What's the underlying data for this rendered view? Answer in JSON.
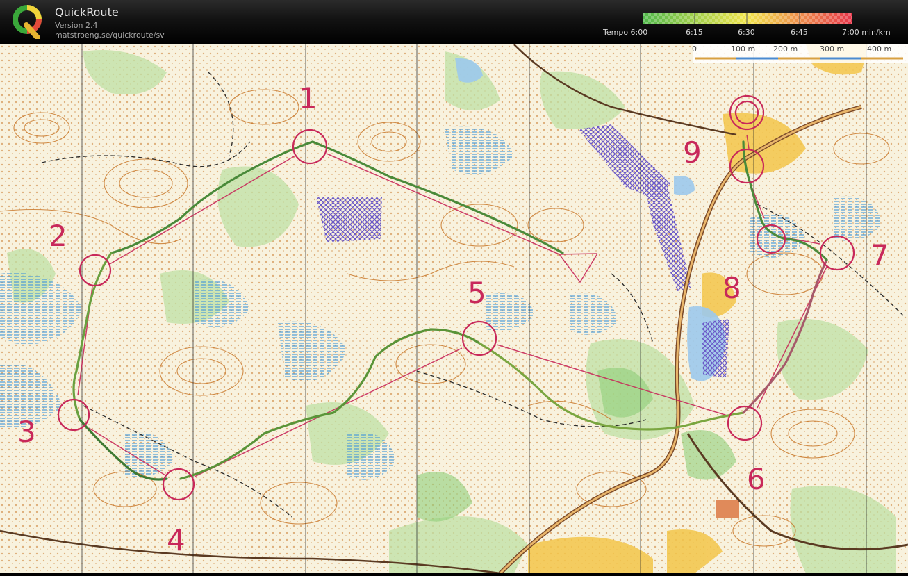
{
  "app": {
    "title": "QuickRoute",
    "version": "Version 2.4",
    "url": "matstroeng.se/quickroute/sv"
  },
  "pace_legend": {
    "prefix": "Tempo",
    "ticks": [
      "6:00",
      "6:15",
      "6:30",
      "6:45",
      "7:00"
    ],
    "unit": "min/km",
    "colors": [
      "#4fb84a",
      "#f2e54a",
      "#e8364a"
    ]
  },
  "map": {
    "scale_labels": [
      "0",
      "100 m",
      "200 m",
      "300 m",
      "400 m"
    ],
    "control_numbers": [
      "1",
      "2",
      "3",
      "4",
      "5",
      "6",
      "7",
      "8",
      "9"
    ],
    "course_color": "#c8285a",
    "route_color": "#4a8a3a"
  }
}
